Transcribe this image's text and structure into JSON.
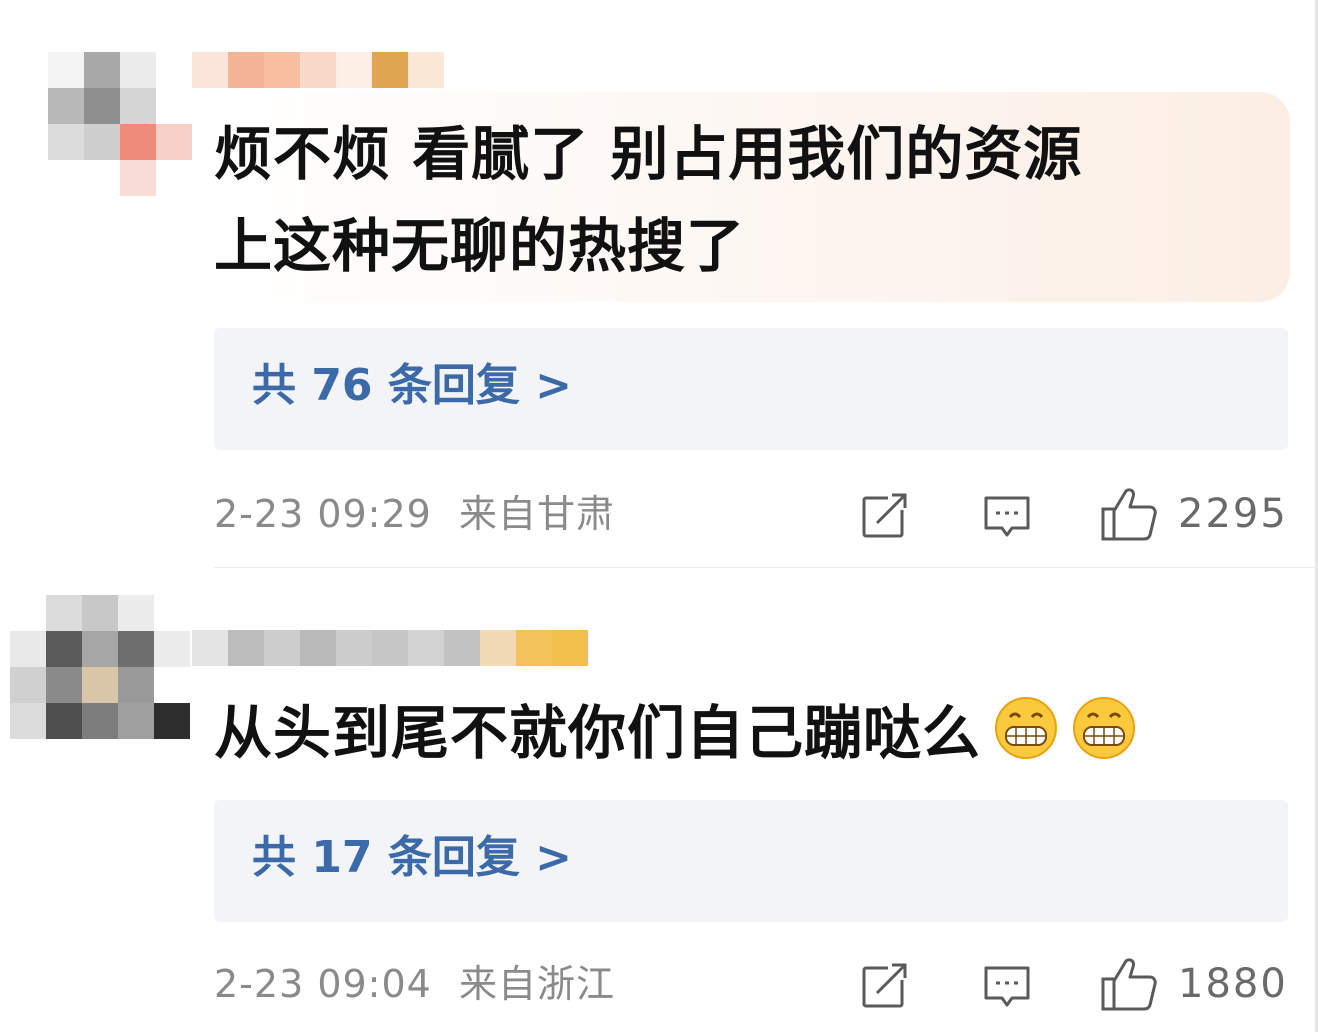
{
  "comments": [
    {
      "text_line1": "烦不烦 看腻了 别占用我们的资源",
      "text_line2": "上这种无聊的热搜了",
      "replies_label": "共 76 条回复 >",
      "timestamp": "2-23 09:29",
      "location": "来自甘肃",
      "like_count": "2295",
      "icons": [
        "share-icon",
        "comment-icon",
        "like-icon"
      ],
      "bubble_decoration": "fried-egg"
    },
    {
      "text": "从头到尾不就你们自己蹦哒么",
      "emoji": [
        "grinning-face-emoji",
        "grinning-face-emoji"
      ],
      "replies_label": "共 17 条回复 >",
      "timestamp": "2-23 09:04",
      "location": "来自浙江",
      "like_count": "1880",
      "icons": [
        "share-icon",
        "comment-icon",
        "like-icon"
      ]
    }
  ],
  "colors": {
    "reply_link": "#3c6aa8",
    "meta_text": "#8a8a8a",
    "reply_box_bg": "#f3f4f7",
    "text": "#111111"
  }
}
